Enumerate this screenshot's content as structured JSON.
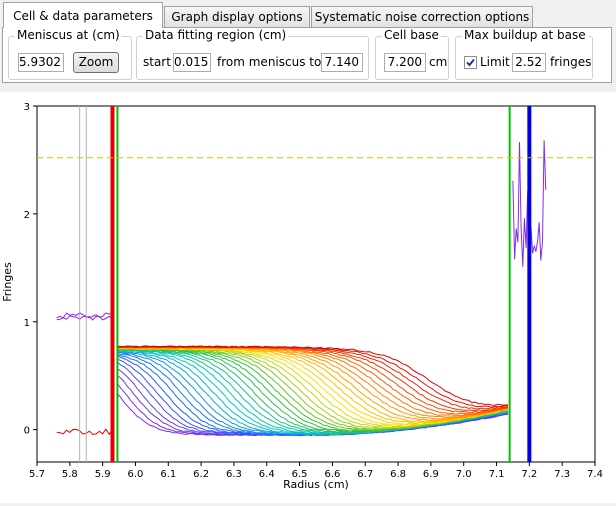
{
  "tabs": [
    {
      "label": "Cell & data parameters",
      "active": true
    },
    {
      "label": "Graph display options",
      "active": false
    },
    {
      "label": "Systematic noise correction options",
      "active": false
    }
  ],
  "meniscus": {
    "group_label": "Meniscus at (cm)",
    "value": "5.9302",
    "zoom_label": "Zoom"
  },
  "fitting": {
    "group_label": "Data fitting region (cm)",
    "start_label": "start",
    "start_value": "0.015",
    "mid_label": "from meniscus to",
    "end_value": "7.140"
  },
  "cell_base": {
    "group_label": "Cell base",
    "value": "7.200",
    "unit": "cm"
  },
  "buildup": {
    "group_label": "Max buildup at base",
    "limit_label": "Limit",
    "checked": true,
    "value": "2.52",
    "unit": "fringes"
  },
  "chart_data": {
    "type": "line",
    "xlabel": "Radius (cm)",
    "ylabel": "Fringes",
    "xlim": [
      5.7,
      7.4
    ],
    "ylim": [
      -0.3,
      3.0
    ],
    "x_ticks": [
      "5.7",
      "5.8",
      "5.9",
      "6.0",
      "6.1",
      "6.2",
      "6.3",
      "6.4",
      "6.5",
      "6.6",
      "6.7",
      "6.8",
      "6.9",
      "7.0",
      "7.1",
      "7.2",
      "7.3",
      "7.4"
    ],
    "y_ticks": [
      "0",
      "1",
      "2",
      "3"
    ],
    "scan_count": 40,
    "scan_colors": [
      "#e00000",
      "#ff7f00",
      "#ffe000",
      "#30c030",
      "#00c8c8",
      "#2060ff",
      "#8a2be2"
    ],
    "meniscus_line": {
      "x": 5.93,
      "color": "#e00000"
    },
    "fit_start_line": {
      "x": 5.945,
      "color": "#00c000"
    },
    "fit_end_line": {
      "x": 7.14,
      "color": "#00c000"
    },
    "cell_base_line": {
      "x": 7.2,
      "color": "#0000e0"
    },
    "max_buildup_line": {
      "y": 2.52,
      "color": "#e0c000"
    },
    "gray_lines": [
      5.83,
      5.85
    ],
    "baseline_plateau": 0.72,
    "first_scan_floor": -0.05,
    "upper_plateau": 1.0,
    "end_value": 1.07
  }
}
